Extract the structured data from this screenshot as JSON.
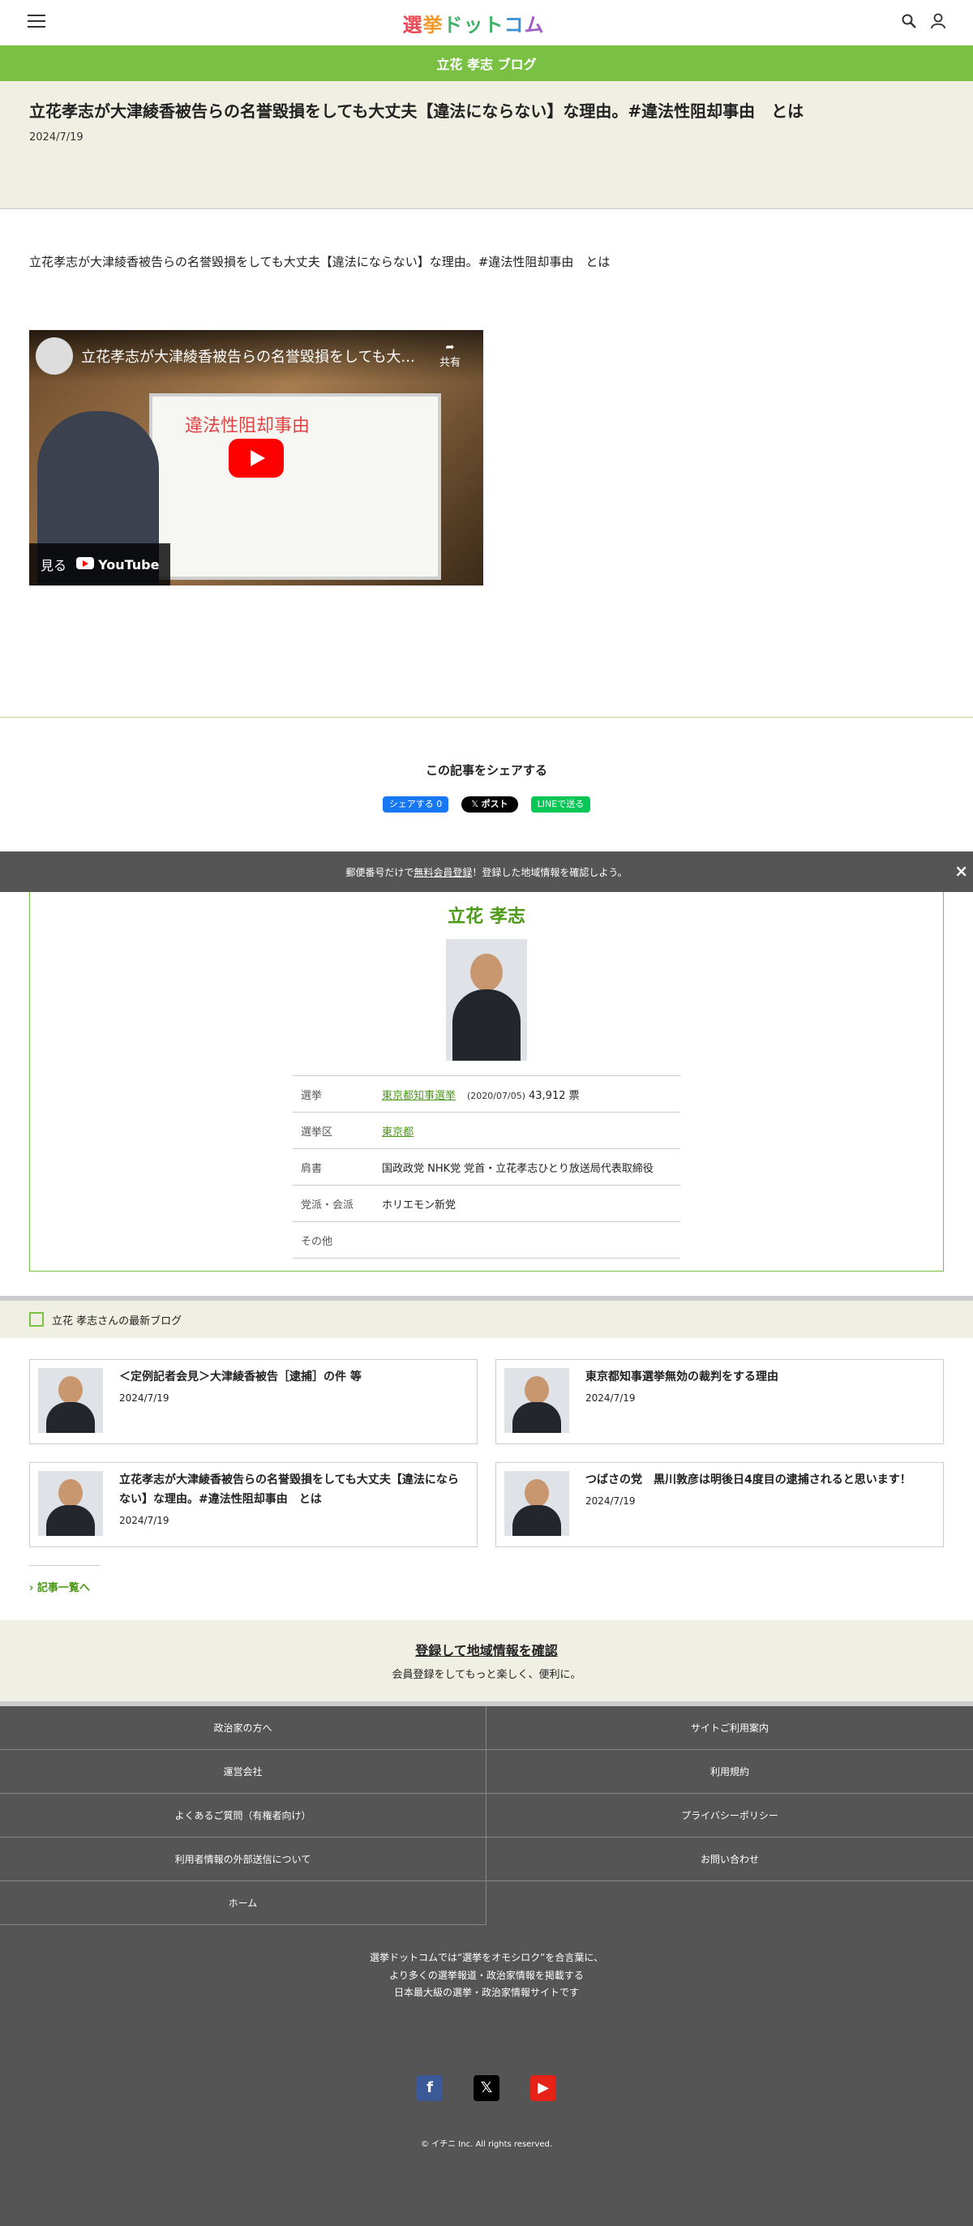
{
  "header": {
    "logo_parts": [
      "選",
      "挙",
      "ドット",
      "コ",
      "ム"
    ]
  },
  "blogbar": {
    "title": "立花 孝志 ブログ"
  },
  "article": {
    "title": "立花孝志が大津綾香被告らの名誉毀損をしても大丈夫【違法にならない】な理由。#違法性阻却事由　とは",
    "date": "2024/7/19",
    "body": "立花孝志が大津綾香被告らの名誉毀損をしても大丈夫【違法にならない】な理由。#違法性阻却事由　とは",
    "video": {
      "title": "立花孝志が大津綾香被告らの名誉毀損をしても大...",
      "share_label": "共有",
      "board_text": "違法性阻却事由",
      "watch_label": "見る",
      "youtube_label": "YouTube"
    }
  },
  "share": {
    "heading": "この記事をシェアする",
    "facebook_label": "シェアする 0",
    "x_label": "ポスト",
    "line_label": "LINEで送る"
  },
  "notice": {
    "prefix": "郵便番号だけで",
    "link": "無料会員登録",
    "suffix": "！登録した地域情報を確認しよう。",
    "close": "×"
  },
  "profile": {
    "name": "立花 孝志",
    "rows": {
      "election_key": "選挙",
      "election_link": "東京都知事選挙",
      "election_date": "(2020/07/05)",
      "election_votes": "43,912 票",
      "district_key": "選挙区",
      "district_value": "東京都",
      "title_key": "肩書",
      "title_value": "国政政党 NHK党 党首・立花孝志ひとり放送局代表取締役",
      "party_key": "党派・会派",
      "party_value": "ホリエモン新党",
      "other_key": "その他",
      "other_value": ""
    }
  },
  "latest": {
    "heading": "立花 孝志さんの最新ブログ",
    "items": [
      {
        "title": "＜定例記者会見＞大津綾香被告［逮捕］の件 等",
        "date": "2024/7/19"
      },
      {
        "title": "東京都知事選挙無効の裁判をする理由",
        "date": "2024/7/19"
      },
      {
        "title": "立花孝志が大津綾香被告らの名誉毀損をしても大丈夫【違法にならない】な理由。#違法性阻却事由　とは",
        "date": "2024/7/19"
      },
      {
        "title": "つばさの党　黒川敦彦は明後日4度目の逮捕されると思います！",
        "date": "2024/7/19"
      }
    ],
    "more": "記事一覧へ"
  },
  "register": {
    "title": "登録して地域情報を確認",
    "sub": "会員登録をしてもっと楽しく、便利に。"
  },
  "footer": {
    "links": [
      "政治家の方へ",
      "サイトご利用案内",
      "運営会社",
      "利用規約",
      "よくあるご質問（有権者向け）",
      "プライバシーポリシー",
      "利用者情報の外部送信について",
      "お問い合わせ",
      "ホーム"
    ],
    "desc_lines": [
      "選挙ドットコムでは“選挙をオモシロク”を合言葉に、",
      "より多くの選挙報道・政治家情報を掲載する",
      "日本最大級の選挙・政治家情報サイトです"
    ],
    "copyright": "© イチニ Inc. All rights reserved."
  }
}
